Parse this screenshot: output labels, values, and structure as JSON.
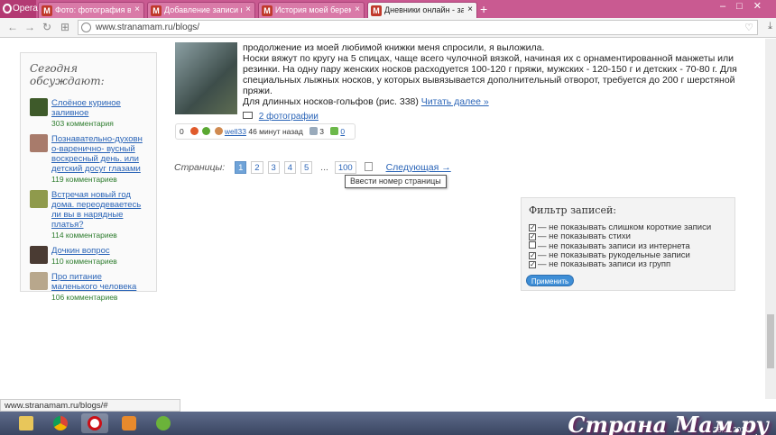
{
  "browser": {
    "menu_label": "Opera",
    "tabs": [
      {
        "label": "Фото: фотография в аль...",
        "active": false
      },
      {
        "label": "Добавление записи в дне...",
        "active": false
      },
      {
        "label": "История моей беремен...",
        "active": false
      },
      {
        "label": "Дневники онлайн - завед...",
        "active": true
      }
    ],
    "url": "www.stranamam.ru/blogs/",
    "status_url": "www.stranamam.ru/blogs/#"
  },
  "sidebar": {
    "title": "Сегодня обсуждают:",
    "items": [
      {
        "title": "Слоёное куриное заливное",
        "comments": "303 комментария"
      },
      {
        "title": "Познавательно-духовн о-варенично- вусный воскресный день. или детский досуг глазами",
        "comments": "119 комментариев"
      },
      {
        "title": "Встречая новый год дома. переодеваетесь ли вы в нарядные платья?",
        "comments": "114 комментариев"
      },
      {
        "title": "Дочкин вопрос",
        "comments": "110 комментариев"
      },
      {
        "title": "Про питание маленького человека",
        "comments": "106 комментариев"
      }
    ]
  },
  "post": {
    "text_intro": "продолжение из моей любимой книжки меня спросили, я выложила.",
    "text_body": "Носки вяжут по кругу на 5 спицах, чаще всего чулочной вязкой, начиная их с орнаментированной манжеты или резинки. На одну пару женских носков расходуется 100-120 г пряжи, мужских - 120-150 г и детских - 70-80 г. Для специальных лыжных носков, у которых вывязывается дополнительный отворот, требуется до 200 г шерстяной пряжи.",
    "text_last": "Для длинных носков-гольфов (рис. 338)",
    "read_more": "Читать далее »",
    "photos_link": "2 фотографии",
    "stats": {
      "rating": "0",
      "author": "well33",
      "time": "46 минут назад",
      "views": "3",
      "comments": "0"
    }
  },
  "pager": {
    "label": "Страницы:",
    "pages": [
      "1",
      "2",
      "3",
      "4",
      "5"
    ],
    "ellipsis": "...",
    "last": "100",
    "next": "Следующая →",
    "tooltip": "Ввести номер страницы"
  },
  "filter": {
    "title": "Фильтр записей:",
    "options": [
      {
        "label": "— не показывать слишком короткие записи",
        "checked": true
      },
      {
        "label": "— не показывать стихи",
        "checked": true
      },
      {
        "label": "— не показывать записи из интернета",
        "checked": false
      },
      {
        "label": "— не показывать рукодельные записи",
        "checked": true
      },
      {
        "label": "— не показывать записи из групп",
        "checked": true
      }
    ],
    "apply": "Применить"
  },
  "watermark": "Страна Мам.ру",
  "clock": "26.11.2013"
}
